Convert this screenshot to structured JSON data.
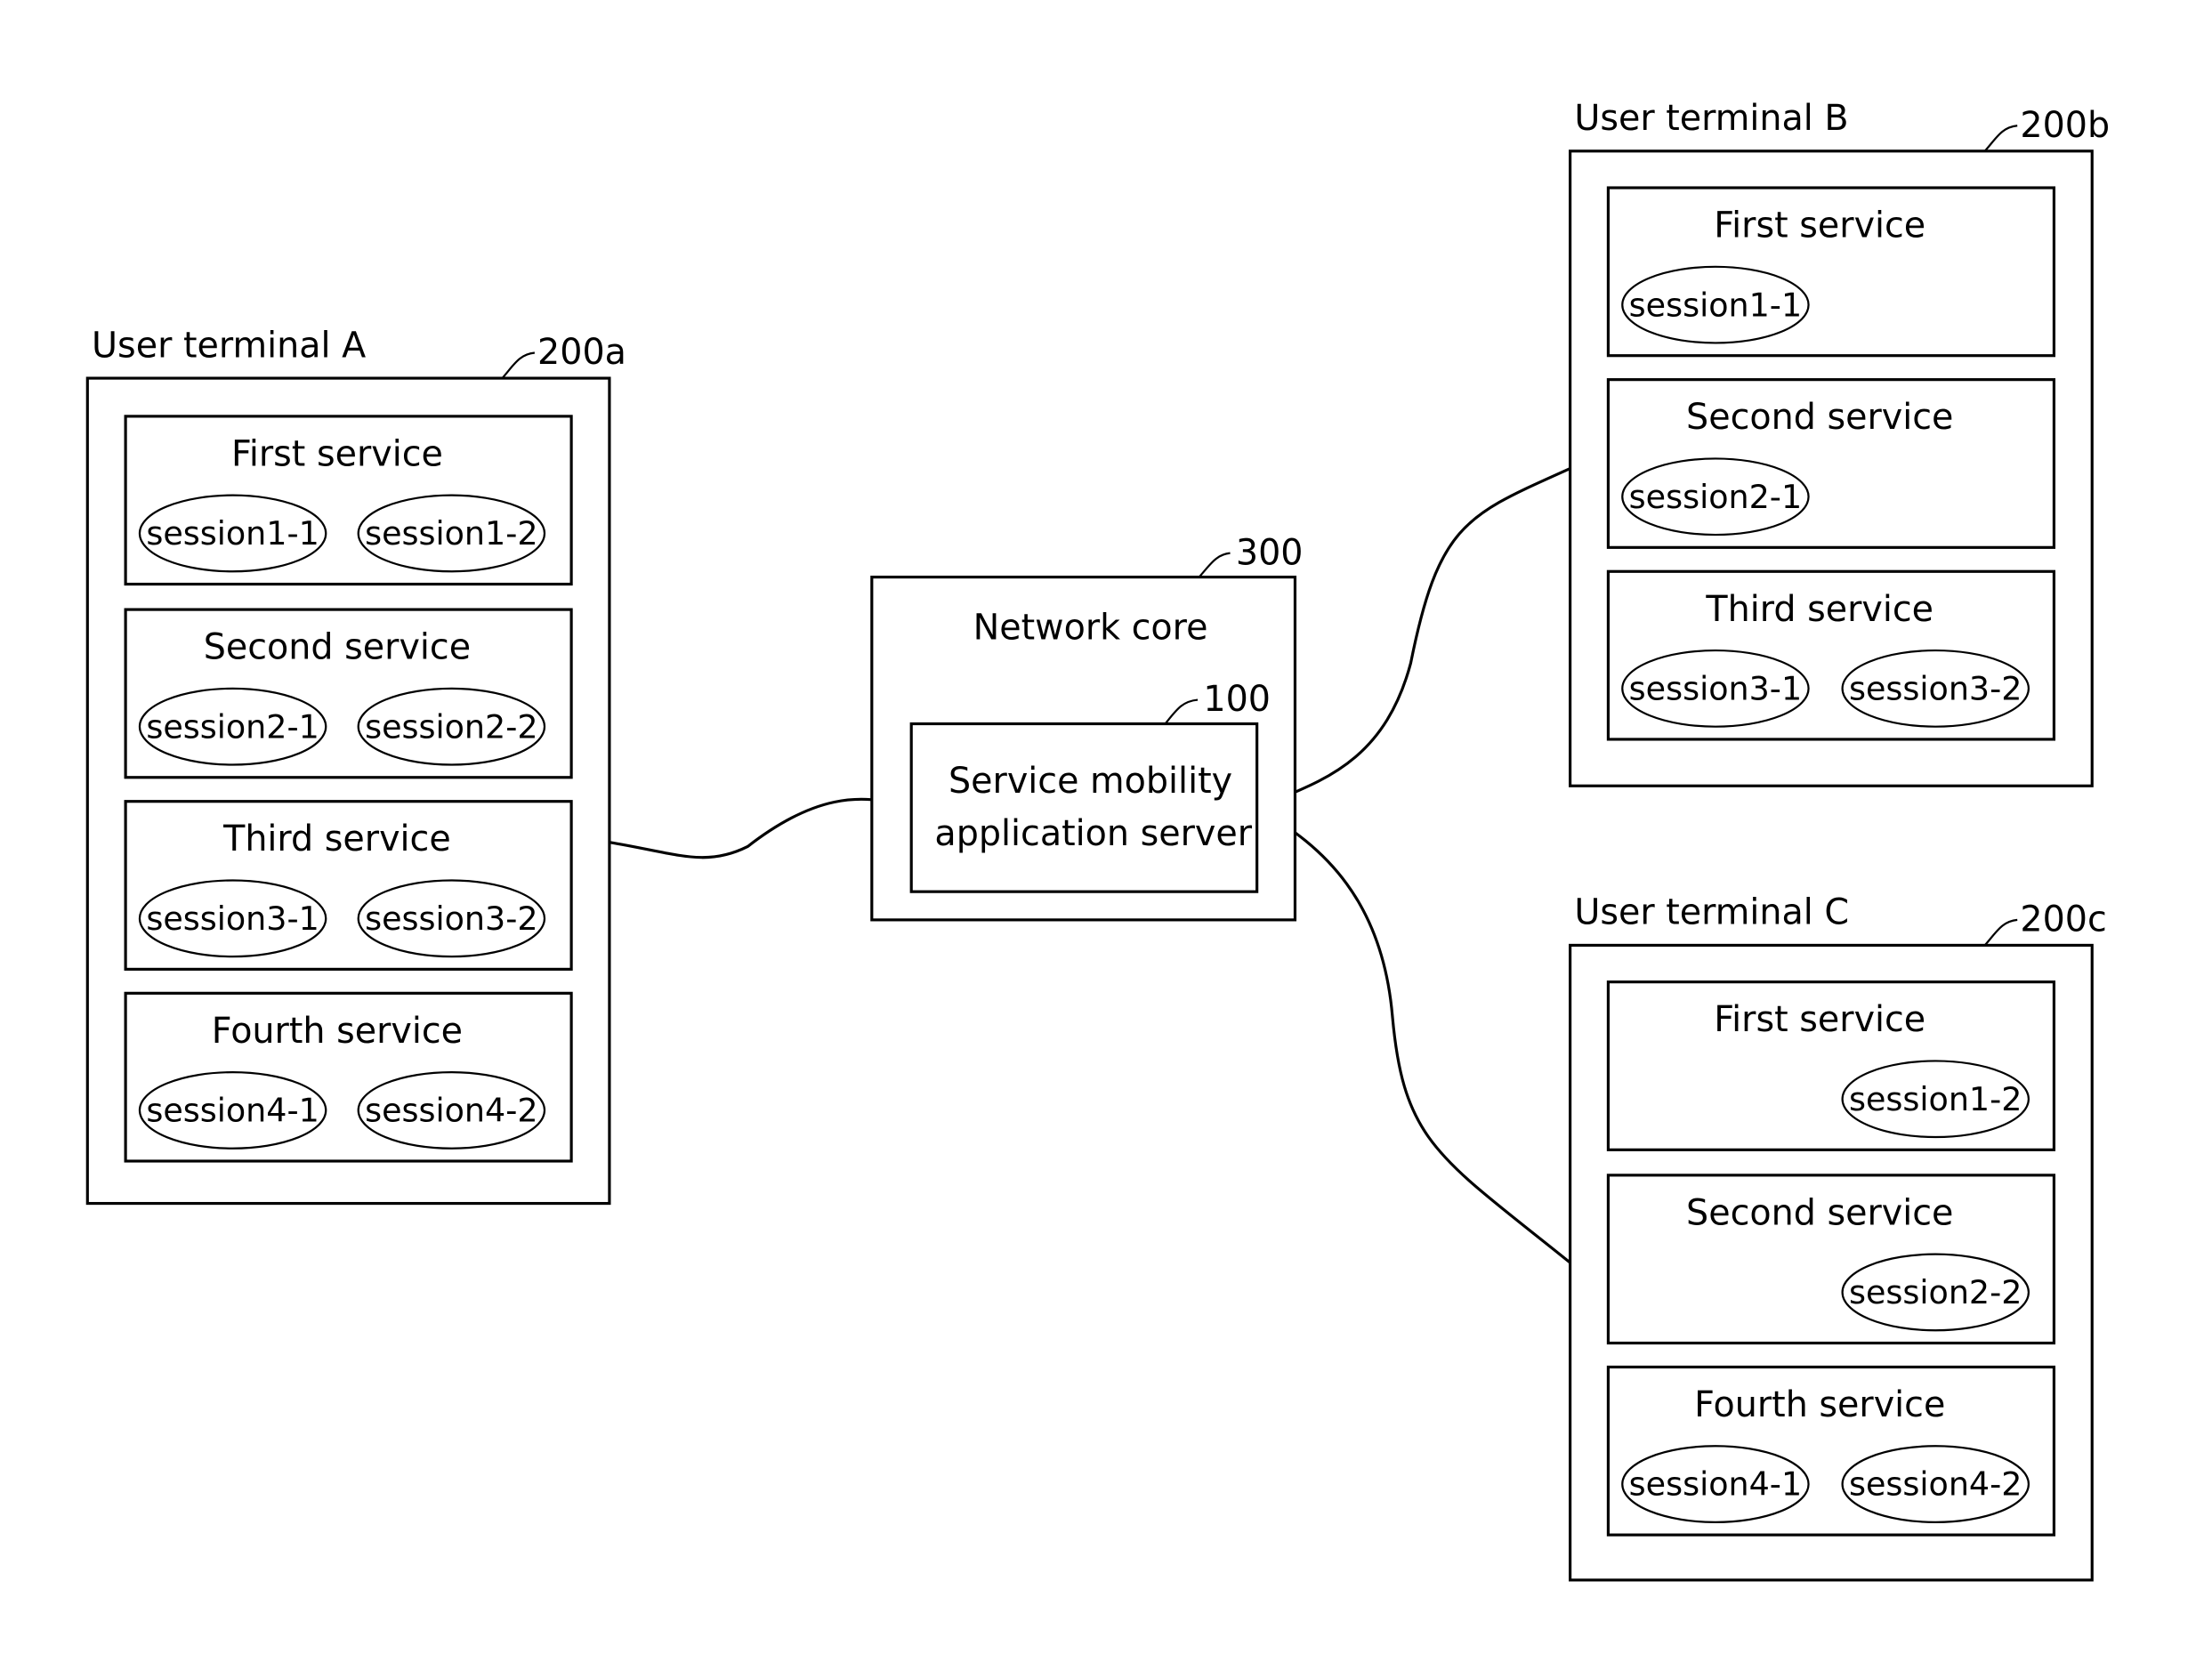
{
  "terminals": [
    {
      "id": "A",
      "label": "User terminal A",
      "ref": "200a",
      "services": [
        {
          "name": "First service",
          "sessions": [
            "session1-1",
            "session1-2"
          ],
          "slots": [
            "left",
            "right"
          ]
        },
        {
          "name": "Second service",
          "sessions": [
            "session2-1",
            "session2-2"
          ],
          "slots": [
            "left",
            "right"
          ]
        },
        {
          "name": "Third service",
          "sessions": [
            "session3-1",
            "session3-2"
          ],
          "slots": [
            "left",
            "right"
          ]
        },
        {
          "name": "Fourth service",
          "sessions": [
            "session4-1",
            "session4-2"
          ],
          "slots": [
            "left",
            "right"
          ]
        }
      ]
    },
    {
      "id": "B",
      "label": "User terminal B",
      "ref": "200b",
      "services": [
        {
          "name": "First service",
          "sessions": [
            "session1-1"
          ],
          "slots": [
            "left"
          ]
        },
        {
          "name": "Second service",
          "sessions": [
            "session2-1"
          ],
          "slots": [
            "left"
          ]
        },
        {
          "name": "Third service",
          "sessions": [
            "session3-1",
            "session3-2"
          ],
          "slots": [
            "left",
            "right"
          ]
        }
      ]
    },
    {
      "id": "C",
      "label": "User terminal C",
      "ref": "200c",
      "services": [
        {
          "name": "First service",
          "sessions": [
            "session1-2"
          ],
          "slots": [
            "right"
          ]
        },
        {
          "name": "Second service",
          "sessions": [
            "session2-2"
          ],
          "slots": [
            "right"
          ]
        },
        {
          "name": "Fourth service",
          "sessions": [
            "session4-1",
            "session4-2"
          ],
          "slots": [
            "left",
            "right"
          ]
        }
      ]
    }
  ],
  "network_core": {
    "label": "Network core",
    "ref": "300",
    "server": {
      "label_line1": "Service mobility",
      "label_line2": "application server",
      "ref": "100"
    }
  },
  "connections": [
    {
      "from": "100",
      "to": "200a"
    },
    {
      "from": "100",
      "to": "200b"
    },
    {
      "from": "100",
      "to": "200c"
    }
  ]
}
